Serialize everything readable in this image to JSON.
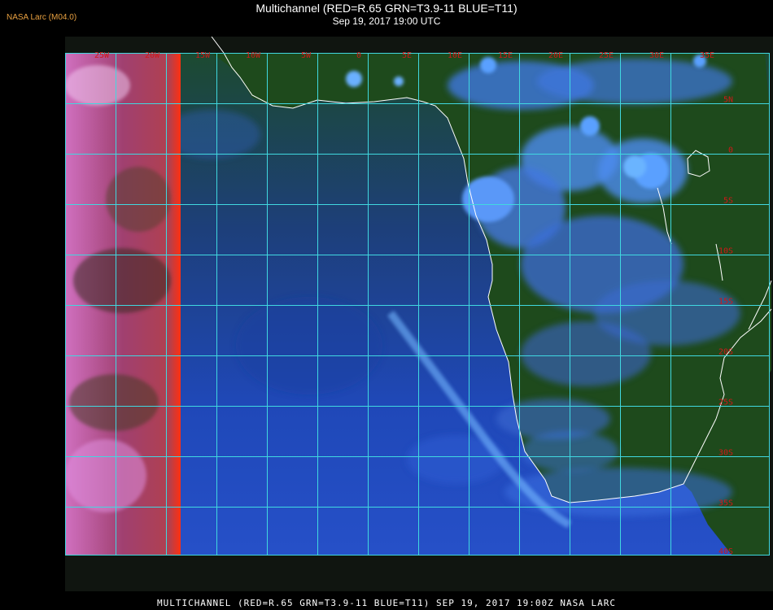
{
  "header": {
    "source_label": "NASA Larc (M04.0)",
    "title": "Multichannel (RED=R.65 GRN=T3.9-11 BLUE=T11)",
    "subtitle": "Sep 19, 2017 19:00 UTC"
  },
  "map": {
    "lon_labels": [
      "25W",
      "20W",
      "15W",
      "10W",
      "5W",
      "0",
      "5E",
      "10E",
      "15E",
      "20E",
      "25E",
      "30E",
      "35E"
    ],
    "lat_labels": [
      "5N",
      "0",
      "5S",
      "10S",
      "15S",
      "20S",
      "25S",
      "30S",
      "35S",
      "40S"
    ],
    "colors": {
      "grid": "#40d8e0",
      "label": "#d01818",
      "coast": "#ffffff",
      "ocean": "#1a3fa8",
      "land": "#1d4a18",
      "cloud": "#5aa8ff",
      "bad_strip": "#c060a0"
    }
  },
  "footer": {
    "text": "MULTICHANNEL (RED=R.65 GRN=T3.9-11 BLUE=T11) SEP 19, 2017 19:00Z  NASA LARC"
  }
}
